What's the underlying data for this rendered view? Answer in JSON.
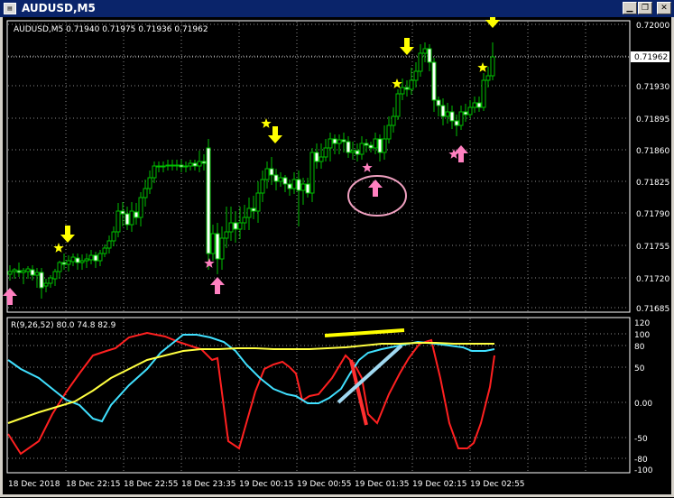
{
  "window": {
    "title": "AUDUSD,M5",
    "buttons": [
      "minimize",
      "maximize",
      "close"
    ]
  },
  "main_chart": {
    "info": "AUDUSD,M5  0.71940 0.71975 0.71936 0.71962",
    "price_ticks": [
      "0.72000",
      "0.71962",
      "0.71930",
      "0.71895",
      "0.71860",
      "0.71825",
      "0.71790",
      "0.71755",
      "0.71720",
      "0.71685"
    ],
    "current_price": "0.71962"
  },
  "indicator": {
    "label": "R(9,26,52) 80.0 74.8 82.9",
    "ticks": [
      "120",
      "100",
      "80",
      "50",
      "0.00",
      "-50",
      "-80",
      "-100"
    ]
  },
  "time_axis": [
    "18 Dec 2018",
    "18 Dec 22:15",
    "18 Dec 22:55",
    "18 Dec 23:35",
    "19 Dec 00:15",
    "19 Dec 00:55",
    "19 Dec 01:35",
    "19 Dec 02:15",
    "19 Dec 02:55"
  ],
  "colors": {
    "candle": "#00c000",
    "grid": "#8a8a8a",
    "buy_arrow": "#ff80c0",
    "sell_arrow": "#ffff00",
    "line_red": "#ff2020",
    "line_cyan": "#40e0ff",
    "line_yellow": "#ffff40"
  }
}
